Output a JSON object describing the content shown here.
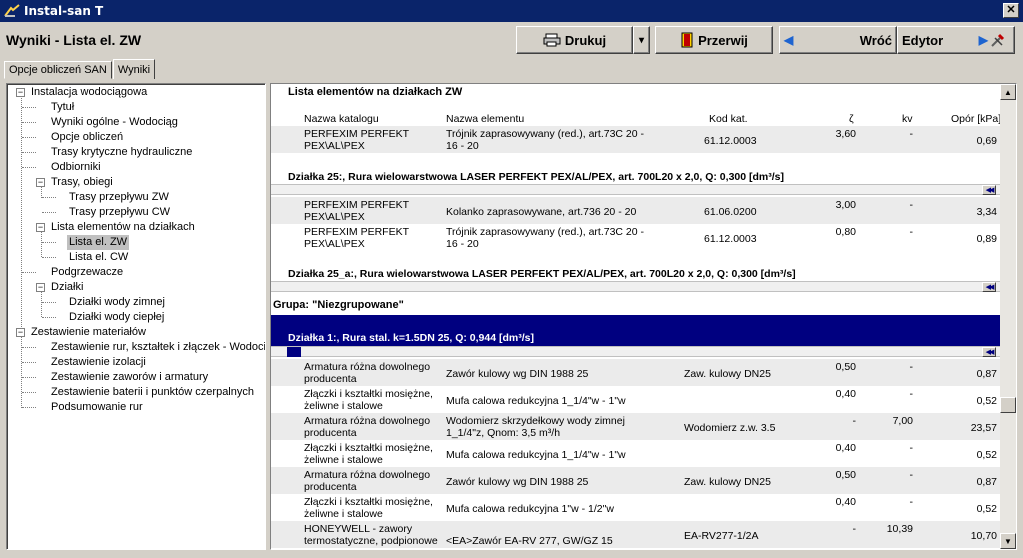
{
  "window": {
    "title": "Instal-san T",
    "close_glyph": "✕"
  },
  "header": {
    "title": "Wyniki - Lista el. ZW",
    "print_label": "Drukuj",
    "print_dropdown": "▾",
    "break_label": "Przerwij",
    "back_arrow": "◀",
    "back_label": "Wróć",
    "editor_label": "Edytor",
    "forward_arrow": "▶"
  },
  "tabs": [
    {
      "label": "Opcje obliczeń SAN"
    },
    {
      "label": "Wyniki"
    }
  ],
  "tree": {
    "root1": "Instalacja wodociągowa",
    "tytul": "Tytuł",
    "wyniki_ogolne": "Wyniki ogólne - Wodociąg",
    "opcje": "Opcje obliczeń",
    "trasy_kryt": "Trasy krytyczne hydrauliczne",
    "odbiorniki": "Odbiorniki",
    "trasy_obiegi": "Trasy, obiegi",
    "trasy_zw": "Trasy przepływu ZW",
    "trasy_cw": "Trasy przepływu CW",
    "lista_el": "Lista elementów na działkach",
    "lista_zw": "Lista el. ZW",
    "lista_cw": "Lista el. CW",
    "podgrzewacze": "Podgrzewacze",
    "dzialki": "Działki",
    "dz_zimnej": "Działki wody zimnej",
    "dz_cieplej": "Działki wody ciepłej",
    "root2": "Zestawienie materiałów",
    "zest_rur": "Zestawienie rur, kształtek i złączek - Wodociąg",
    "zest_izol": "Zestawienie izolacji",
    "zest_zaw": "Zestawienie zaworów i armatury",
    "zest_bat": "Zestawienie baterii i punktów czerpalnych",
    "podsum": "Podsumowanie rur",
    "expanded": "−"
  },
  "content": {
    "heading": "Lista elementów na działkach ZW",
    "collapse_glyph": "◀◀",
    "columns": {
      "katalog": "Nazwa katalogu",
      "element": "Nazwa elementu",
      "kod": "Kod kat.",
      "zeta": "ζ",
      "kv": "kv",
      "opor": "Opór [kPa]"
    },
    "row0": {
      "kat1": "PERFEXIM PERFEKT",
      "kat2": "PEX\\AL\\PEX",
      "el1": "Trójnik zaprasowywany (red.), art.73C 20 -",
      "el2": "16 - 20",
      "kod": "61.12.0003",
      "zeta": "3,60",
      "kv": "-",
      "opor": "0,69"
    },
    "dz25": "Działka 25:, Rura wielowarstwowa LASER PERFEKT PEX/AL/PEX, art. 700L20 x 2,0, Q: 0,300 [dm³/s]",
    "row1": {
      "kat1": "PERFEXIM PERFEKT",
      "kat2": "PEX\\AL\\PEX",
      "el1": "Kolanko zaprasowywane, art.736 20 - 20",
      "kod": "61.06.0200",
      "zeta": "3,00",
      "kv": "-",
      "opor": "3,34"
    },
    "row2": {
      "kat1": "PERFEXIM PERFEKT",
      "kat2": "PEX\\AL\\PEX",
      "el1": "Trójnik zaprasowywany (red.), art.73C 20 -",
      "el2": "16 - 20",
      "kod": "61.12.0003",
      "zeta": "0,80",
      "kv": "-",
      "opor": "0,89"
    },
    "dz25a": "Działka 25_a:, Rura wielowarstwowa LASER PERFEKT PEX/AL/PEX, art. 700L20 x 2,0, Q: 0,300 [dm³/s]",
    "grupa": "Grupa: \"Niezgrupowane\"",
    "dz1": "Działka 1:, Rura stal. k=1.5DN 25, Q: 0,944 [dm³/s]",
    "rows": [
      {
        "kat1": "Armatura różna dowolnego",
        "kat2": "producenta",
        "el1": "Zawór kulowy wg DIN 1988 25",
        "el2": "",
        "kod": "Zaw. kulowy DN25",
        "zeta": "0,50",
        "kv": "-",
        "opor": "0,87"
      },
      {
        "kat1": "Złączki i kształtki mosiężne,",
        "kat2": "żeliwne i stalowe",
        "el1": "Mufa calowa redukcyjna 1_1/4\"w - 1\"w",
        "el2": "",
        "kod": "",
        "zeta": "0,40",
        "kv": "-",
        "opor": "0,52"
      },
      {
        "kat1": "Armatura różna dowolnego",
        "kat2": "producenta",
        "el1": "Wodomierz skrzydełkowy wody zimnej",
        "el2": "1_1/4\"z, Qnom: 3,5 m³/h",
        "kod": "Wodomierz z.w. 3.5",
        "zeta": "-",
        "kv": "7,00",
        "opor": "23,57"
      },
      {
        "kat1": "Złączki i kształtki mosiężne,",
        "kat2": "żeliwne i stalowe",
        "el1": "Mufa calowa redukcyjna 1_1/4\"w - 1\"w",
        "el2": "",
        "kod": "",
        "zeta": "0,40",
        "kv": "-",
        "opor": "0,52"
      },
      {
        "kat1": "Armatura różna dowolnego",
        "kat2": "producenta",
        "el1": "Zawór kulowy wg DIN 1988 25",
        "el2": "",
        "kod": "Zaw. kulowy DN25",
        "zeta": "0,50",
        "kv": "-",
        "opor": "0,87"
      },
      {
        "kat1": "Złączki i kształtki mosiężne,",
        "kat2": "żeliwne i stalowe",
        "el1": "Mufa calowa redukcyjna 1\"w - 1/2\"w",
        "el2": "",
        "kod": "",
        "zeta": "0,40",
        "kv": "-",
        "opor": "0,52"
      },
      {
        "kat1": "HONEYWELL - zawory",
        "kat2": "termostatyczne, podpionowe",
        "el1": "",
        "el2": "<EA>Zawór EA-RV 277, GW/GZ 15",
        "kod": "EA-RV277-1/2A",
        "zeta": "-",
        "kv": "10,39",
        "opor": "10,70"
      }
    ],
    "scroll_up": "▲",
    "scroll_down": "▼"
  }
}
